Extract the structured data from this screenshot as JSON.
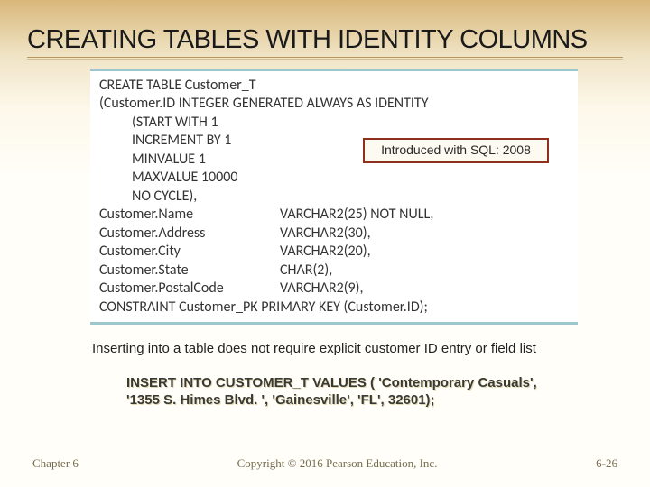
{
  "title": "CREATING TABLES WITH IDENTITY COLUMNS",
  "callout": "Introduced with SQL: 2008",
  "code": {
    "l1": "CREATE TABLE Customer_T",
    "l2": "(Customer.ID INTEGER GENERATED ALWAYS AS IDENTITY",
    "l3": "(START WITH 1",
    "l4": "INCREMENT BY 1",
    "l5": "MINVALUE 1",
    "l6": "MAXVALUE 10000",
    "l7": "NO CYCLE),",
    "cols": [
      {
        "left": "Customer.Name",
        "right": "VARCHAR2(25) NOT NULL,"
      },
      {
        "left": "Customer.Address",
        "right": "VARCHAR2(30),"
      },
      {
        "left": "Customer.City",
        "right": "VARCHAR2(20),"
      },
      {
        "left": "Customer.State",
        "right": "CHAR(2),"
      },
      {
        "left": "Customer.PostalCode",
        "right": "VARCHAR2(9),"
      }
    ],
    "l13": "CONSTRAINT Customer_PK PRIMARY KEY (Customer.ID);"
  },
  "note": "Inserting into a table does not require explicit customer ID entry or field list",
  "insert": "INSERT INTO CUSTOMER_T VALUES ( 'Contemporary Casuals', '1355 S. Himes Blvd. ', 'Gainesville', 'FL', 32601);",
  "footer": {
    "left": "Chapter 6",
    "center": "Copyright © 2016 Pearson Education, Inc.",
    "right": "6-26"
  }
}
